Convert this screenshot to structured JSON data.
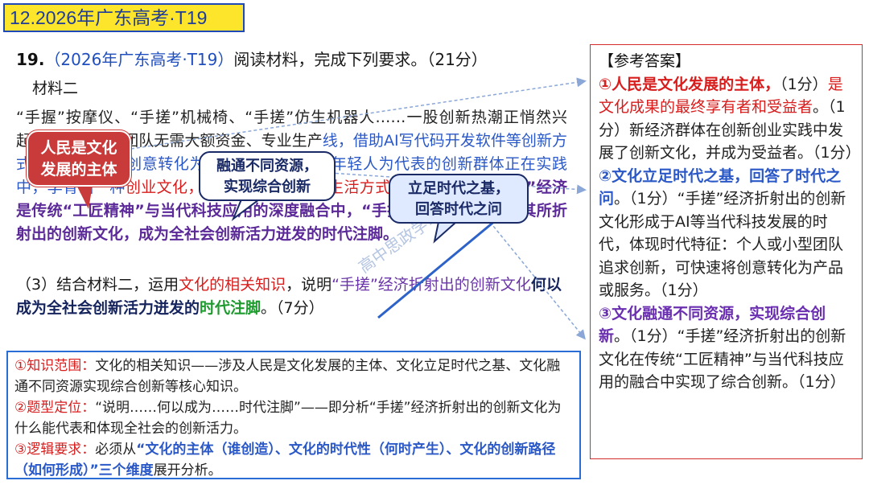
{
  "title_tag": "12.2026年广东高考·T19",
  "question": {
    "number": "19.",
    "source": "（2026年广东高考·T19）",
    "prompt": "阅读材料，完成下列要求。（21分）"
  },
  "material_label": "材料二",
  "passage": {
    "seg1": "“手握”按摩仪、“手搓”机械椅、“手搓”仿生机器人……一股",
    "seg2": "创新热潮正悄然兴起。个人或小型团队无需大额资金、专业生产",
    "seg3": "线，借助AI写代码开发软件等创新方式，可以快速将创意转化为产品",
    "seg4": "或服务。这些年轻人为代表的创新群体正在实践中，孕育出一种",
    "seg5": "创业文化，追求创新成为一种生活方式和价值导向。",
    "seg6": "“手搓”经济是传统“工匠精神”与当代科技应用的深度融合中，“手搓”经济方兴未艾，其所折射出的创新文化，成为全社会创新活力迸发的时代注脚。"
  },
  "question_part": {
    "lead": "（3）结合材料二，运用",
    "red": "文化的相关知识",
    "mid": "，说明",
    "purple": "“手搓”经济折射出的创新文化",
    "strong": "何以成为全社会创新活力迸发的",
    "green": "时代注脚",
    "tail": "。（7分）"
  },
  "bubbles": {
    "b1": [
      "人民是文化",
      "发展的主体"
    ],
    "b2": [
      "融通不同资源，",
      "实现综合创新"
    ],
    "b3": [
      "立足时代之基，",
      "回答时代之问"
    ]
  },
  "answer": {
    "header": "【参考答案】",
    "p1_title": "①人民是文化发展的主体，",
    "p1_score": "（1分）",
    "p1_red": "是文化成果的最终享有者和受益者",
    "p1_rest": "。（1分）新经济群体在创新创业实践中发展了创新文化，并成为受益者。（1分）",
    "p2_title": "②文化立足时代之基，回答了时代之问",
    "p2_rest": "。（1分）“手搓”经济折射出的创新文化形成于AI等当代科技发展的时代，体现时代特征：个人或小型团队追求创新，可快速将创意转化为产品或服务。（1分）",
    "p3_title": "③文化融通不同资源，实现综合创新",
    "p3_rest": "。（1分）“手搓”经济折射出的创新文化在传统“工匠精神”与当代科技应用的融合中实现了综合创新。（1分）"
  },
  "analysis": {
    "l1_red": "①知识范围：",
    "l1": "文化的相关知识——涉及人民是文化发展的主体、文化立足时代之基、文化融通不同资源实现综合创新等核心知识。",
    "l2_red": "②题型定位：",
    "l2": "“说明……何以成为……时代注脚”——即分析“手搓”经济折射出的创新文化为什么能代表和体现全社会的创新活力。",
    "l3_red": "③逻辑要求：",
    "l3_a": "必须从",
    "l3_blue": "“文化的主体（谁创造）、文化的时代性（何时产生）、文化的创新路径（如何形成）”三个维度",
    "l3_b": "展开分析。"
  },
  "watermark": "高中思政学习",
  "colors": {
    "title_bg": "#fde52b",
    "answer_border": "#d42b2b",
    "analysis_border": "#2a6dd6",
    "bubble_red": "#c93a3a"
  }
}
